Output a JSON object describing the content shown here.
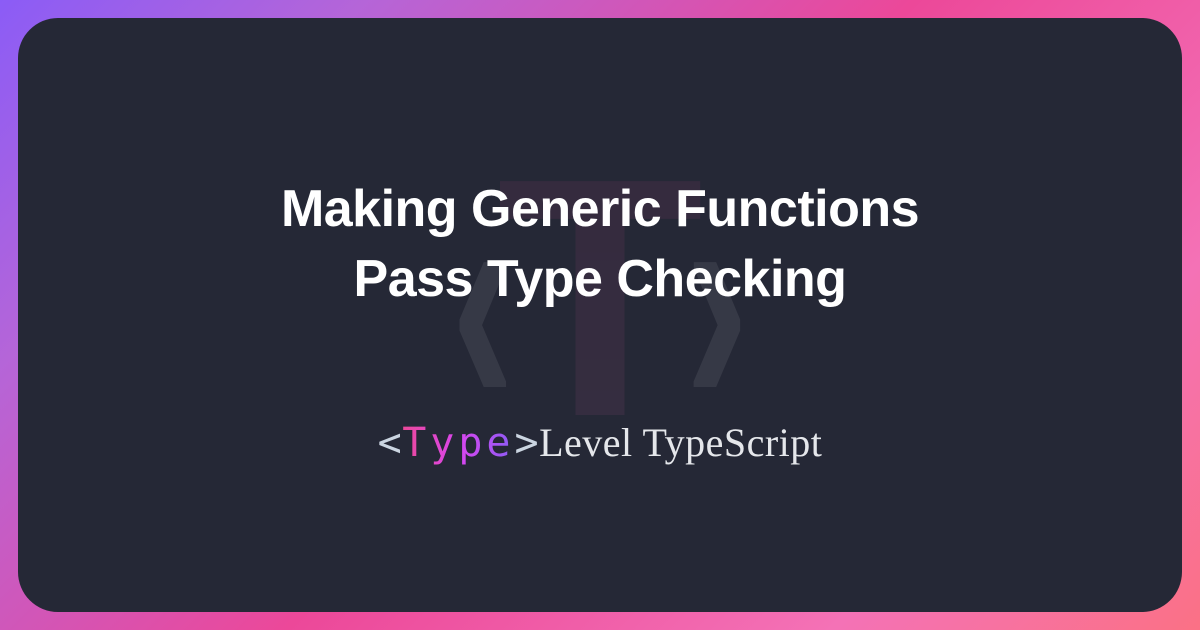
{
  "card": {
    "title_line1": "Making Generic Functions",
    "title_line2": "Pass Type Checking",
    "brand": {
      "angle_open": "<",
      "type_word": "Type",
      "angle_close": ">",
      "rest": "Level TypeScript"
    }
  },
  "colors": {
    "gradient_start": "#8b5cf6",
    "gradient_end": "#fb7185",
    "card_bg": "#252836",
    "text": "#ffffff"
  }
}
